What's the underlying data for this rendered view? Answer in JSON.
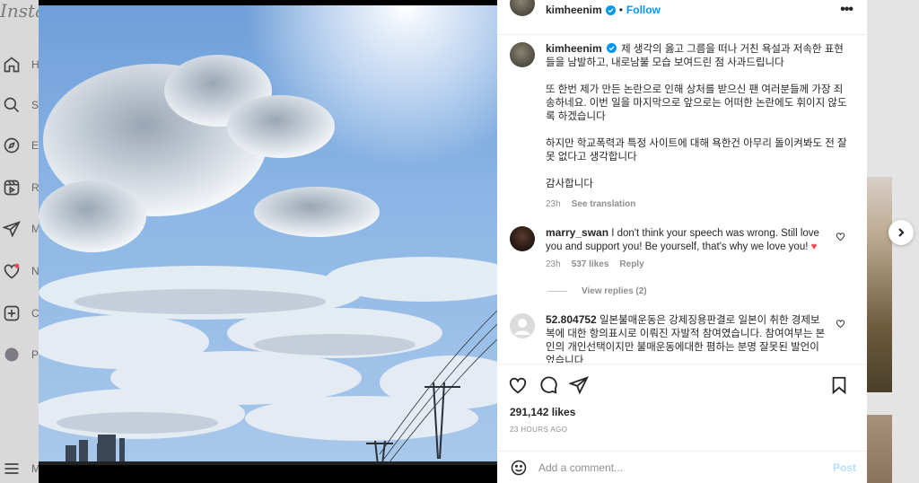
{
  "background": {
    "logo": "Insta",
    "nav": [
      {
        "icon": "home-icon",
        "label": "H"
      },
      {
        "icon": "search-icon",
        "label": "S"
      },
      {
        "icon": "explore-icon",
        "label": "E"
      },
      {
        "icon": "reels-icon",
        "label": "R"
      },
      {
        "icon": "messages-icon",
        "label": "M"
      },
      {
        "icon": "notifications-icon",
        "label": "N"
      },
      {
        "icon": "create-icon",
        "label": "C"
      },
      {
        "icon": "profile-icon",
        "label": "P"
      },
      {
        "icon": "menu-icon",
        "label": "M"
      }
    ]
  },
  "post": {
    "header": {
      "username": "kimheenim",
      "separator": "•",
      "follow_label": "Follow",
      "more_label": "•••"
    },
    "caption": {
      "username": "kimheenim",
      "paragraphs": [
        "제 생각의 옳고 그름을 떠나 거친 욕설과 저속한 표현들을 남발하고, 내로남불 모습 보여드린 점 사과드립니다",
        "또 한번 제가 만든 논란으로 인해 상처를 받으신 팬 여러분들께 가장 죄송하네요. 이번 일을 마지막으로 앞으로는 어떠한 논란에도 휘이지 않도록 하겠습니다",
        "하지만 학교폭력과 특정 사이트에 대해 욕한건 아무리 돌이켜봐도 전 잘못 없다고 생각합니다",
        "감사합니다"
      ],
      "time": "23h",
      "see_translation": "See translation"
    },
    "comments": [
      {
        "username": "marry_swan",
        "text": "I don't think your speech was wrong. Still love you and support you! Be yourself, that's why we love you!",
        "emoji": "♥",
        "time": "23h",
        "likes": "537 likes",
        "reply": "Reply",
        "view_replies": "View replies (2)"
      },
      {
        "username": "52.804752",
        "text": "일본불매운동은 강제징용판결로 일본이 취한 경제보복에 대한 항의표시로 이뤄진 자발적 참여였습니다. 참여여부는 본인의 개인선택이지만 불매운동에대한 폄하는 분명 잘못된 발언이었습니다"
      }
    ],
    "likes": "291,142 likes",
    "time_ago": "23 HOURS AGO",
    "add_comment_placeholder": "Add a comment...",
    "post_label": "Post"
  },
  "colors": {
    "link_blue": "#0095f6",
    "post_disabled": "#b2dffc",
    "heart_red": "#ed4956"
  }
}
